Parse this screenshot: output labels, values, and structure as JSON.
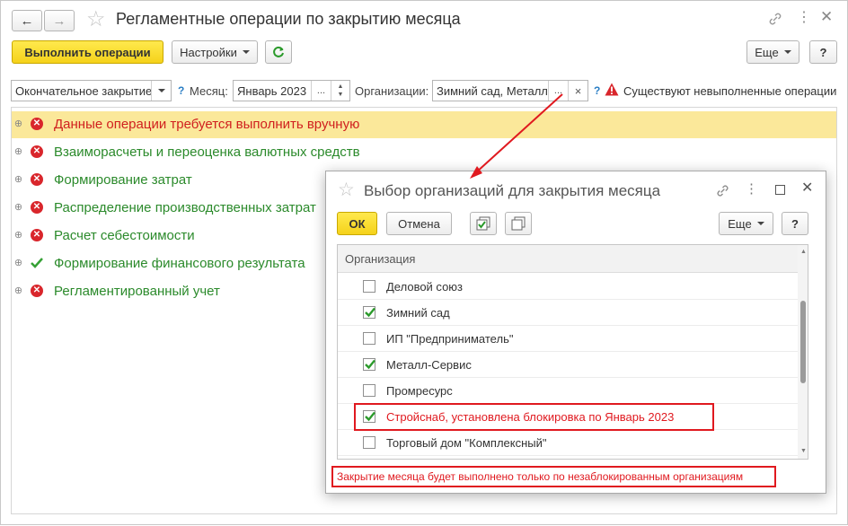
{
  "window": {
    "title": "Регламентные операции по закрытию месяца",
    "nav_back": "←",
    "nav_forward": "→"
  },
  "toolbar": {
    "run_label": "Выполнить операции",
    "settings_label": "Настройки",
    "more_label": "Еще",
    "help_label": "?"
  },
  "filters": {
    "mode_value": "Окончательное закрытие",
    "month_label": "Месяц:",
    "month_value": "Январь 2023",
    "month_select": "...",
    "org_label": "Организации:",
    "org_value": "Зимний сад, Металл",
    "org_select": "...",
    "org_clear": "×",
    "help": "?",
    "warning_text": "Существуют невыполненные операции"
  },
  "operations": [
    {
      "label": "Данные операции требуется выполнить вручную",
      "status": "error",
      "highlight": true
    },
    {
      "label": "Взаиморасчеты и переоценка валютных средств",
      "status": "error",
      "highlight": false
    },
    {
      "label": "Формирование затрат",
      "status": "error",
      "highlight": false
    },
    {
      "label": "Распределение производственных затрат",
      "status": "error",
      "highlight": false
    },
    {
      "label": "Расчет себестоимости",
      "status": "error",
      "highlight": false
    },
    {
      "label": "Формирование финансового результата",
      "status": "ok",
      "highlight": false
    },
    {
      "label": "Регламентированный учет",
      "status": "error",
      "highlight": false
    }
  ],
  "dialog": {
    "title": "Выбор организаций для закрытия месяца",
    "ok_label": "ОК",
    "cancel_label": "Отмена",
    "more_label": "Еще",
    "help_label": "?",
    "column_header": "Организация",
    "rows": [
      {
        "label": "Деловой союз",
        "checked": false
      },
      {
        "label": "Зимний сад",
        "checked": true
      },
      {
        "label": "ИП \"Предприниматель\"",
        "checked": false
      },
      {
        "label": "Металл-Сервис",
        "checked": true
      },
      {
        "label": "Промресурс",
        "checked": false
      },
      {
        "label": "Стройснаб,  установлена блокировка по Январь 2023",
        "checked": true,
        "blocked": true
      },
      {
        "label": "Торговый дом \"Комплексный\"",
        "checked": false
      }
    ],
    "footer_note": "Закрытие месяца будет выполнено только по незаблокированным организациям"
  },
  "colors": {
    "accent_yellow": "#f5d21a",
    "error_red": "#d9262c",
    "ok_green": "#2b8a2b",
    "highlight_row": "#fbe89a",
    "annotation_red": "#e0191f"
  }
}
